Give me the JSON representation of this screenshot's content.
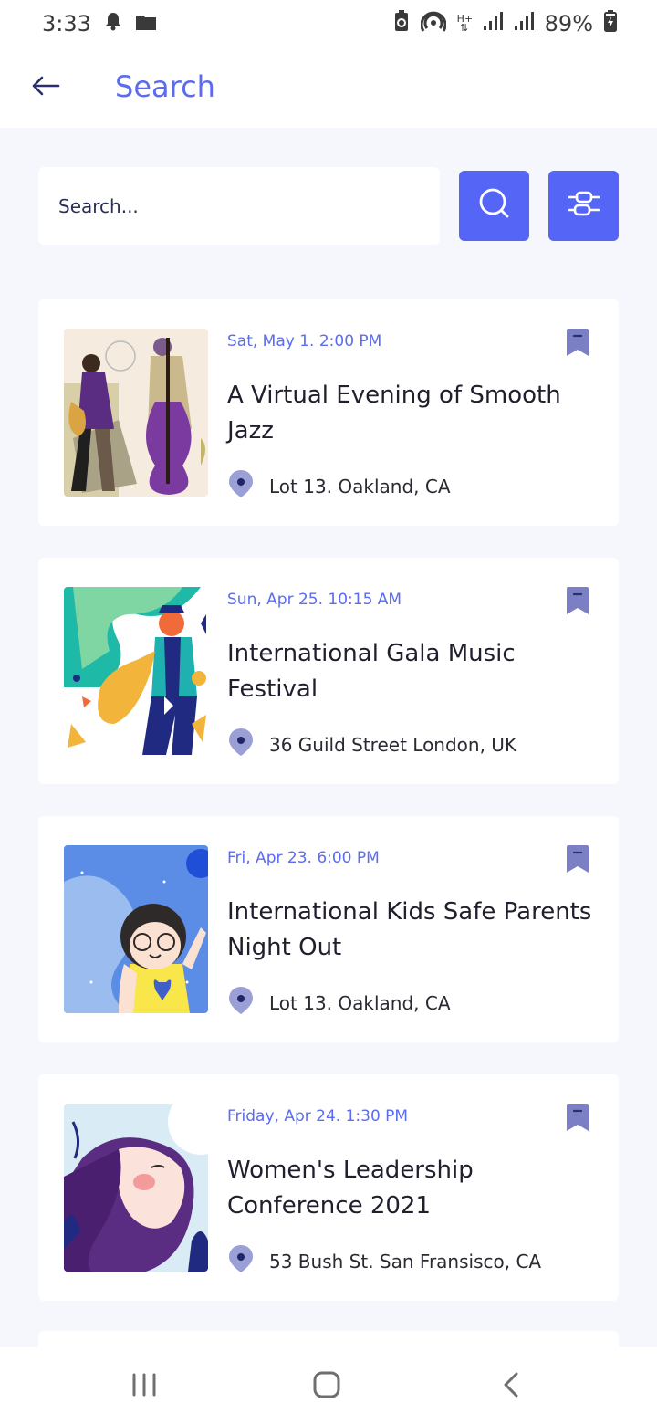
{
  "status_bar": {
    "time": "3:33",
    "battery": "89%",
    "icons": [
      "bell-icon",
      "folder-icon",
      "battery-saver-icon",
      "hotspot-icon",
      "data-arrows-icon",
      "signal-icon",
      "signal-icon",
      "battery-charging-icon"
    ],
    "network": "H+"
  },
  "header": {
    "title": "Search",
    "back_icon": "arrow-left-icon"
  },
  "search": {
    "placeholder": "Search...",
    "value": "",
    "search_icon": "search-icon",
    "filter_icon": "sliders-icon"
  },
  "colors": {
    "accent": "#5566f6",
    "title": "#5b6cf0",
    "bookmark": "#7a80c3",
    "pin": "#9aa0d6",
    "background": "#f6f7fd"
  },
  "events": [
    {
      "date": "Sat, May 1. 2:00 PM",
      "title": "A Virtual Evening of Smooth Jazz",
      "location": "Lot 13. Oakland, CA"
    },
    {
      "date": "Sun, Apr 25. 10:15 AM",
      "title": "International Gala Music Festival",
      "location": "36 Guild Street London, UK"
    },
    {
      "date": "Fri, Apr 23. 6:00 PM",
      "title": "International Kids Safe Parents Night Out",
      "location": "Lot 13. Oakland, CA"
    },
    {
      "date": "Friday, Apr 24. 1:30 PM",
      "title": "Women's Leadership Conference 2021",
      "location": "53 Bush St. San Fransisco, CA"
    }
  ],
  "nav": {
    "recents_icon": "recents-icon",
    "home_icon": "home-icon",
    "back_icon": "nav-back-icon"
  }
}
